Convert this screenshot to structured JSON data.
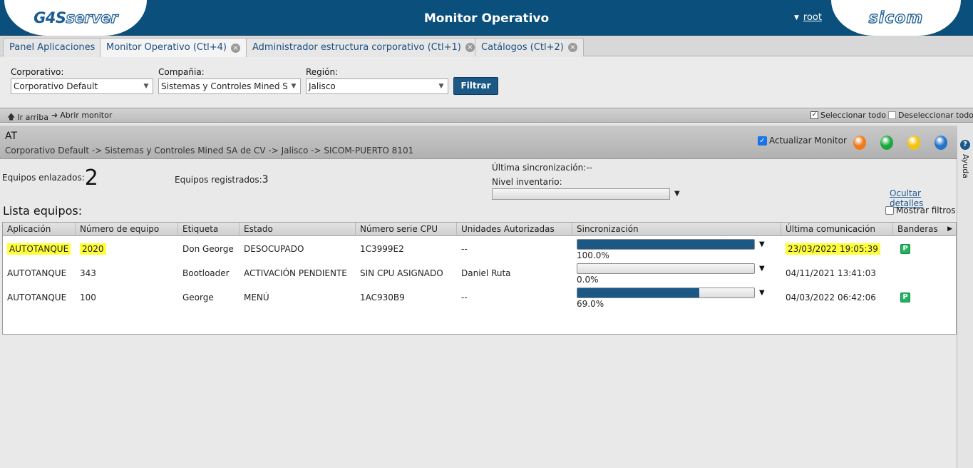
{
  "header": {
    "logo_left_a": "G4S",
    "logo_left_b": "server",
    "title": "Monitor Operativo",
    "user": "root",
    "logo_right": "sicom"
  },
  "tabs": [
    {
      "label": "Panel Aplicaciones"
    },
    {
      "label": "Monitor Operativo (Ctl+4)"
    },
    {
      "label": "Administrador estructura corporativo (Ctl+1)"
    },
    {
      "label": "Catálogos (Ctl+2)"
    }
  ],
  "filters": {
    "corporativo_label": "Corporativo:",
    "corporativo_value": "Corporativo Default",
    "compania_label": "Compañia:",
    "compania_value": "Sistemas y Controles Mined SA de CV",
    "region_label": "Región:",
    "region_value": "Jalisco",
    "filtrar_label": "Filtrar"
  },
  "toolbar": {
    "ir_arriba": "Ir arriba",
    "abrir_monitor": "Abrir monitor",
    "seleccionar_todo": "Seleccionar todo",
    "deseleccionar_todo": "Deseleccionar todo"
  },
  "panel": {
    "title": "AT",
    "path": "Corporativo Default -> Sistemas y Controles Mined SA de CV -> Jalisco -> SICOM-PUERTO 8101",
    "actualizar_label": "Actualizar Monitor",
    "led_colors": [
      "#f07a1a",
      "#1aa83c",
      "#f2c40f",
      "#2574c9"
    ],
    "help_label": "Ayuda"
  },
  "stats": {
    "enlazados_label": "Equipos enlazados:",
    "enlazados_value": "2",
    "registrados_label": "Equipos registrados:",
    "registrados_value": "3",
    "ultima_sync_label": "Última sincronización:",
    "ultima_sync_value": "--",
    "nivel_inventario_label": "Nivel inventario:",
    "ocultar_detalles": "Ocultar detalles",
    "lista_title": "Lista equipos:",
    "mostrar_filtros": "Mostrar filtros"
  },
  "grid": {
    "columns": [
      "Aplicación",
      "Número de equipo",
      "Etiqueta",
      "Estado",
      "Número serie CPU",
      "Unidades Autorizadas",
      "Sincronización",
      "Última comunicación",
      "Banderas"
    ],
    "rows": [
      {
        "aplicacion": "AUTOTANQUE",
        "numero": "2020",
        "etiqueta": "Don George",
        "estado": "DESOCUPADO",
        "serie": "1C3999E2",
        "unidades": "--",
        "sync_pct": 100.0,
        "sync_label": "100.0%",
        "ultima": "23/03/2022 19:05:39",
        "bandera": "P"
      },
      {
        "aplicacion": "AUTOTANQUE",
        "numero": "343",
        "etiqueta": "Bootloader",
        "estado": "ACTIVACIÓN PENDIENTE",
        "serie": "SIN CPU ASIGNADO",
        "unidades": "Daniel Ruta",
        "sync_pct": 0.0,
        "sync_label": "0.0%",
        "ultima": "04/11/2021 13:41:03",
        "bandera": ""
      },
      {
        "aplicacion": "AUTOTANQUE",
        "numero": "100",
        "etiqueta": "George",
        "estado": "MENÚ",
        "serie": "1AC930B9",
        "unidades": "--",
        "sync_pct": 69.0,
        "sync_label": "69.0%",
        "ultima": "04/03/2022 06:42:06",
        "bandera": "P"
      }
    ]
  }
}
